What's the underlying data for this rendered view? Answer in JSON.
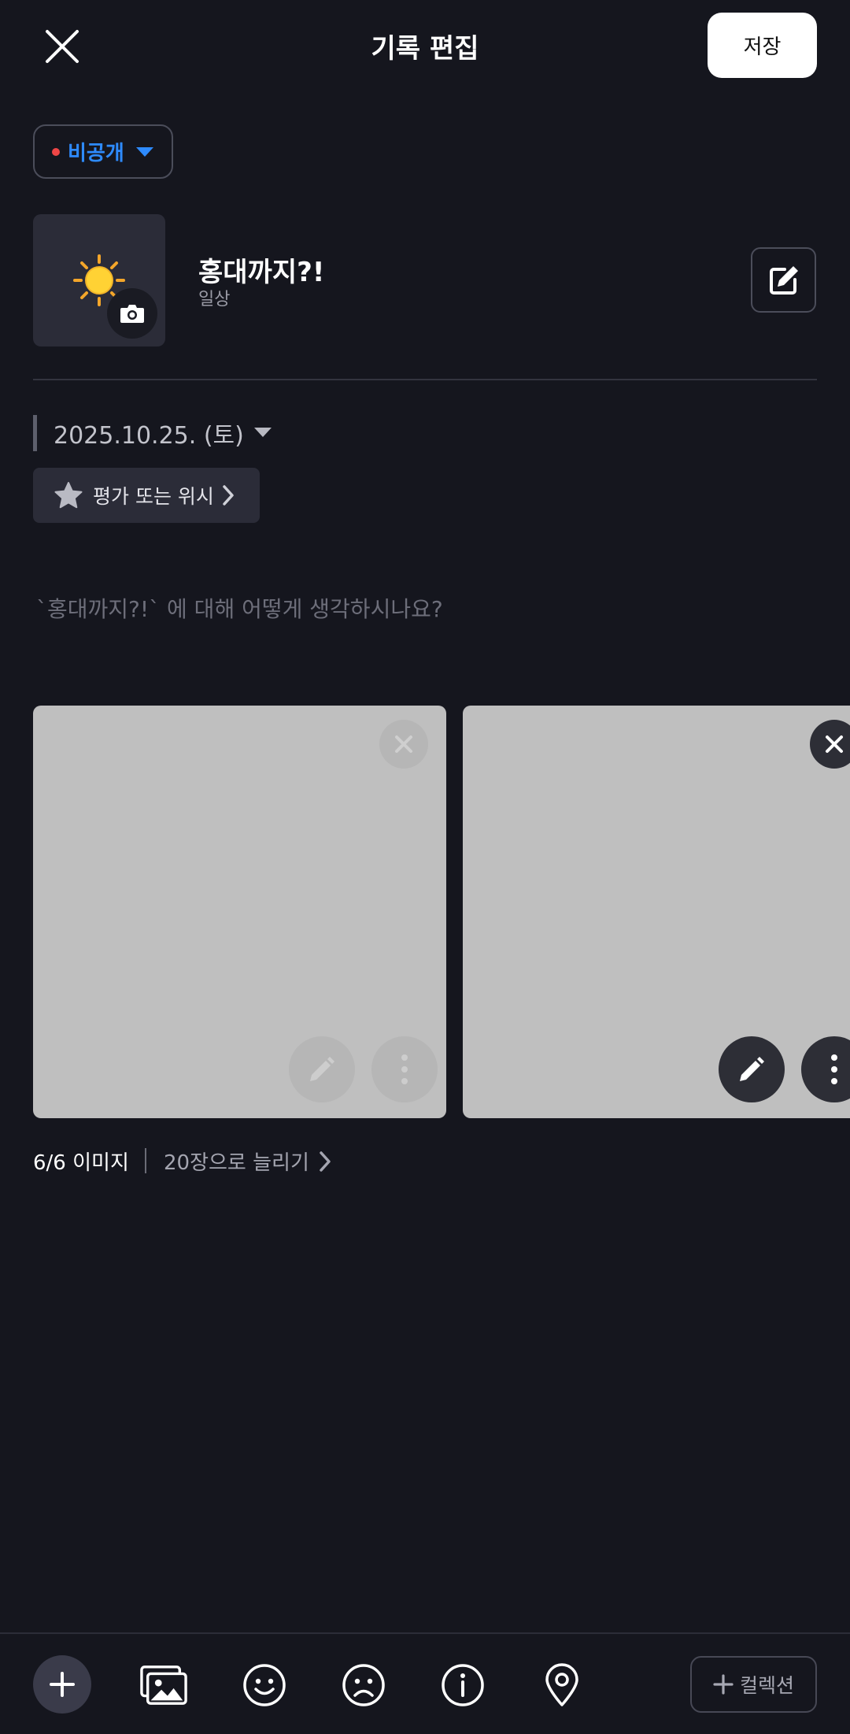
{
  "header": {
    "title": "기록 편집",
    "save_label": "저장",
    "close_icon": "close-icon"
  },
  "visibility": {
    "label": "비공개",
    "dot_color": "#ef4646",
    "label_color": "#2e8bff"
  },
  "item": {
    "title": "홍대까지?!",
    "category": "일상",
    "thumbnail_icon": "sun-icon",
    "badge_icon": "camera-icon",
    "edit_icon": "edit-icon"
  },
  "date": {
    "text": "2025.10.25. (토)"
  },
  "rating": {
    "label": "평가 또는 위시",
    "icon": "star-icon"
  },
  "review": {
    "placeholder": "`홍대까지?!` 에 대해 어떻게 생각하시나요?"
  },
  "images": {
    "count_label": "6/6 이미지",
    "increase_label": "20장으로 늘리기",
    "cards": [
      {
        "name": "image-1",
        "actions": [
          "remove-icon",
          "pencil-icon",
          "more-icon"
        ]
      },
      {
        "name": "image-2",
        "actions": [
          "remove-icon",
          "pencil-icon",
          "more-icon"
        ]
      }
    ]
  },
  "bottom_bar": {
    "tools": [
      "add-icon",
      "gallery-icon",
      "smile-icon",
      "frown-icon",
      "info-icon",
      "location-pin-icon"
    ],
    "collection_label": "컬렉션"
  },
  "colors": {
    "background": "#15161e",
    "accent": "#2e8bff",
    "card": "#2b2c38"
  }
}
